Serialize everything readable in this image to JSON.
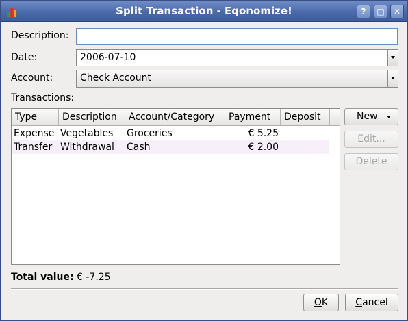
{
  "window": {
    "title": "Split Transaction - Eqonomize!",
    "buttons": {
      "help": "?",
      "maximize": "□",
      "close": "✕"
    }
  },
  "form": {
    "description_label": "Description:",
    "description_value": "",
    "date_label": "Date:",
    "date_value": "2006-07-10",
    "account_label": "Account:",
    "account_value": "Check Account",
    "transactions_label": "Transactions:"
  },
  "table": {
    "columns": [
      "Type",
      "Description",
      "Account/Category",
      "Payment",
      "Deposit"
    ],
    "rows": [
      {
        "type": "Expense",
        "description": "Vegetables",
        "category": "Groceries",
        "payment": "€ 5.25",
        "deposit": ""
      },
      {
        "type": "Transfer",
        "description": "Withdrawal",
        "category": "Cash",
        "payment": "€ 2.00",
        "deposit": ""
      }
    ]
  },
  "side_buttons": {
    "new_prefix": "N",
    "new_rest": "ew",
    "edit": "Edit...",
    "delete": "Delete"
  },
  "total": {
    "label": "Total value:",
    "value": "€ -7.25"
  },
  "dialog_buttons": {
    "ok_prefix": "O",
    "ok_rest": "K",
    "cancel_prefix": "C",
    "cancel_rest": "ancel"
  },
  "colors": {
    "titlebar": "#4b6aa9",
    "focus": "#6b8cc8",
    "alt_row": "#f7f0fa"
  },
  "icons": {
    "app": "chart-bars-icon",
    "new_dropdown": "chevron-down-icon"
  }
}
